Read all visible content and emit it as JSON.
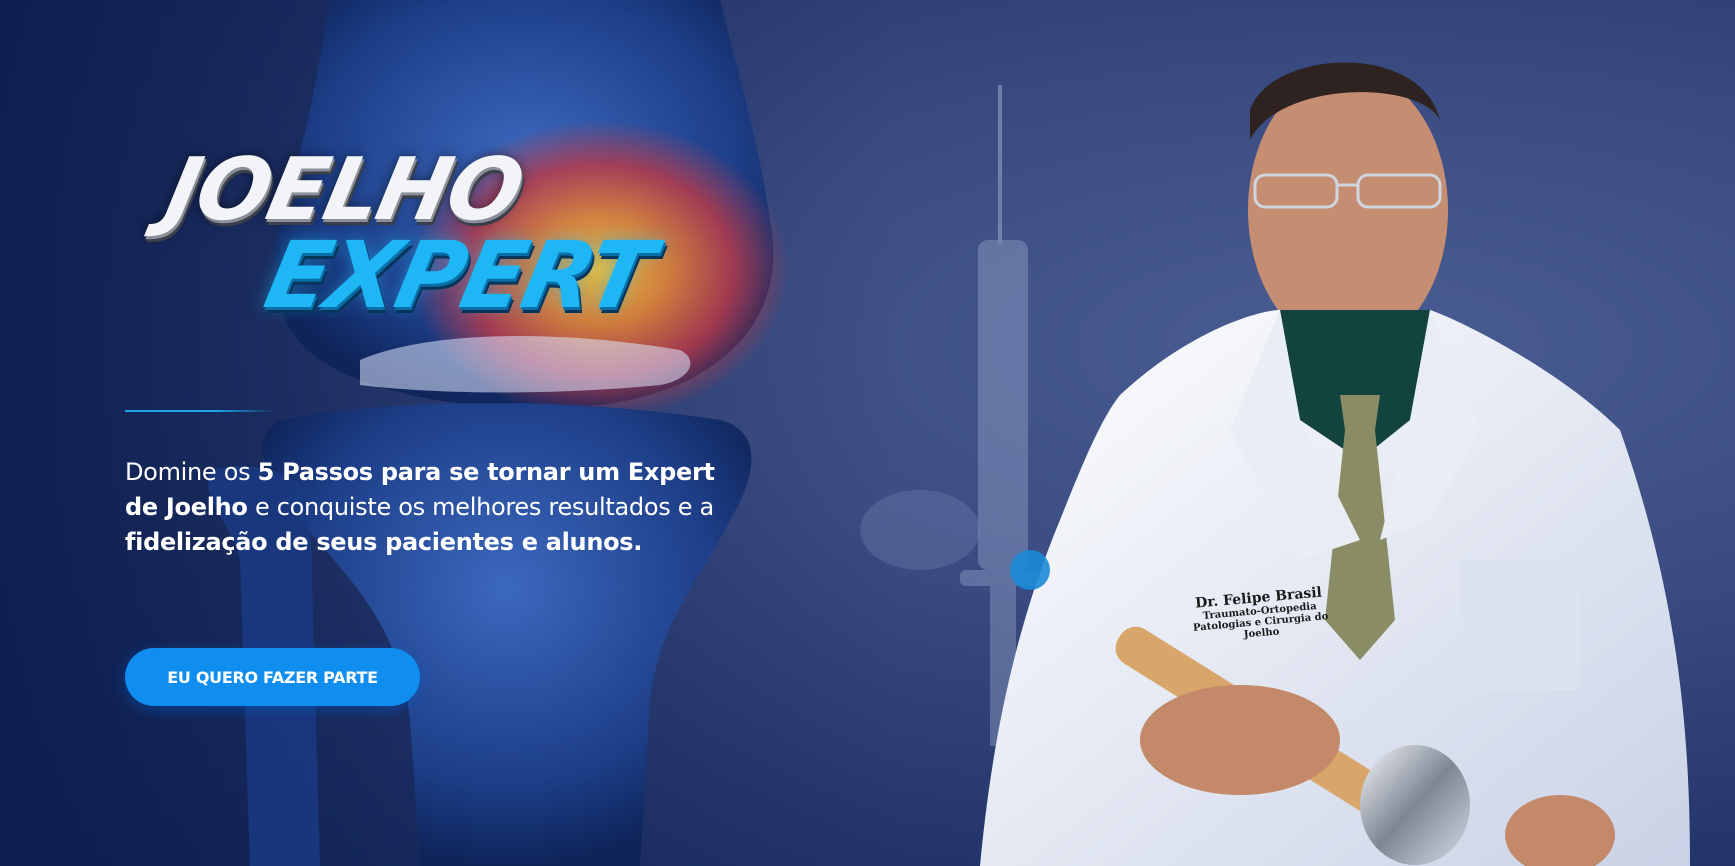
{
  "logo": {
    "line1": "JOELHO",
    "line2": "EXPERT"
  },
  "hero": {
    "tagline": {
      "p1": "Domine os ",
      "b1": "5 Passos para se tornar um Expert de Joelho",
      "p2": " e conquiste os melhores resultados e a ",
      "b2": "fidelização de seus pacientes e alunos."
    },
    "cta_label": "EU QUERO FAZER PARTE"
  },
  "coat_badge": {
    "name": "Dr. Felipe Brasil",
    "specialty": "Traumato-Ortopedia",
    "focus": "Patologias e Cirurgia do Joelho"
  },
  "colors": {
    "accent": "#0f8eef",
    "logo_blue": "#1eb6f5",
    "background": "#2b3c72"
  }
}
